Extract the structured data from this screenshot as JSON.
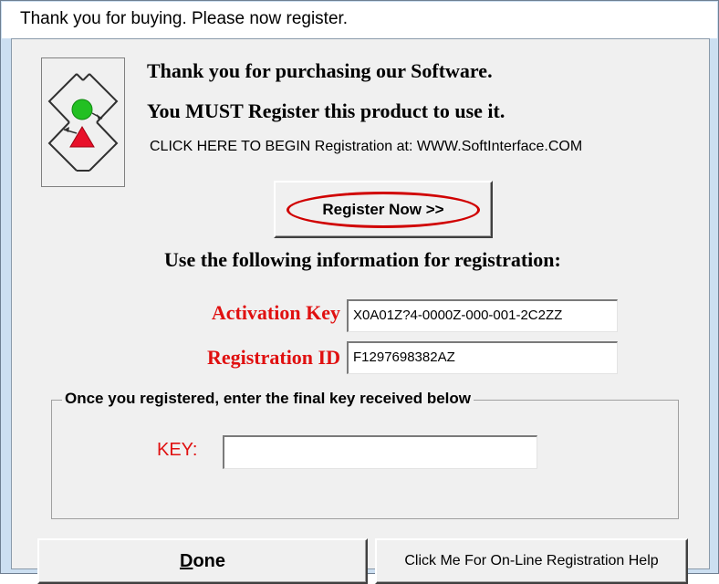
{
  "window": {
    "title": "Thank you for buying.  Please now register."
  },
  "header": {
    "line1": "Thank you for purchasing our Software.",
    "line2": "You MUST Register this product to use it.",
    "click_line": "CLICK HERE TO BEGIN Registration at: WWW.SoftInterface.COM"
  },
  "register_button": {
    "label": "Register Now >>"
  },
  "info_heading": "Use the following information for registration:",
  "activation_key": {
    "label": "Activation Key",
    "value": "X0A01Z?4-0000Z-000-001-2C2ZZ"
  },
  "registration_id": {
    "label": "Registration ID",
    "value": "F1297698382AZ"
  },
  "final_key_group": {
    "legend": "Once you registered, enter the final key received below",
    "key_label": "KEY:",
    "key_value": ""
  },
  "buttons": {
    "done_first": "D",
    "done_rest": "one",
    "help": "Click Me For On-Line Registration Help"
  },
  "colors": {
    "accent_red": "#e01010",
    "ring_red": "#d00000",
    "logo_green": "#22c022",
    "logo_red": "#e8102a"
  },
  "icons": {
    "logo": "diamond-arrows-logo-icon"
  }
}
